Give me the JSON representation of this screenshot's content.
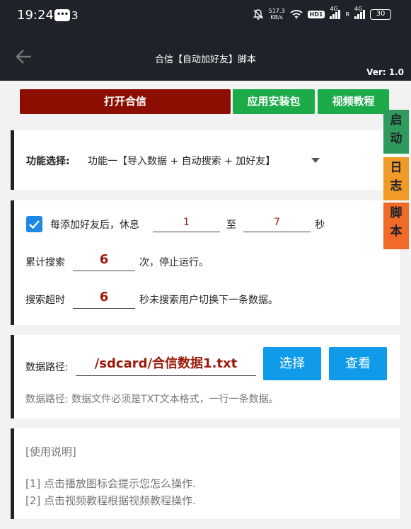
{
  "status": {
    "time": "19:24",
    "chat_icon_text": "•••",
    "chat_count": "3",
    "net_speed_value": "517.3",
    "net_speed_unit": "KB/s",
    "hd_label": "HD1",
    "signal1_label": "4G",
    "signal2_label": "4G",
    "roaming_label": "R",
    "battery": "30"
  },
  "appbar": {
    "title": "合信【自动加好友】脚本",
    "version": "Ver: 1.0"
  },
  "actions": {
    "open_app": "打开合信",
    "install_pkg": "应用安装包",
    "video_tutorial": "视频教程"
  },
  "side_tabs": {
    "start_1": "启",
    "start_2": "动",
    "log_1": "日",
    "log_2": "志",
    "script_1": "脚",
    "script_2": "本"
  },
  "function": {
    "label": "功能选择:",
    "selected": "功能一【导入数据 + 自动搜索 + 加好友】"
  },
  "settings": {
    "checkbox_checked": true,
    "rest_prefix": "每添加好友后，休息",
    "rest_min": "1",
    "rest_to": "至",
    "rest_max": "7",
    "rest_unit": "秒",
    "search_prefix": "累计搜索",
    "search_count": "6",
    "search_suffix": "次，停止运行。",
    "timeout_prefix": "搜索超时",
    "timeout_value": "6",
    "timeout_suffix": "秒未搜索用户切换下一条数据。"
  },
  "data_path": {
    "label": "数据路径:",
    "value": "/sdcard/合信数据1.txt",
    "choose_button": "选择",
    "view_button": "查看",
    "hint": "数据路径: 数据文件必须是TXT文本格式，一行一条数据。"
  },
  "instructions": {
    "title": "[使用说明]",
    "line1": "[1] 点击播放图标会提示您怎么操作.",
    "line2": "[2] 点击视频教程根据视频教程操作."
  }
}
